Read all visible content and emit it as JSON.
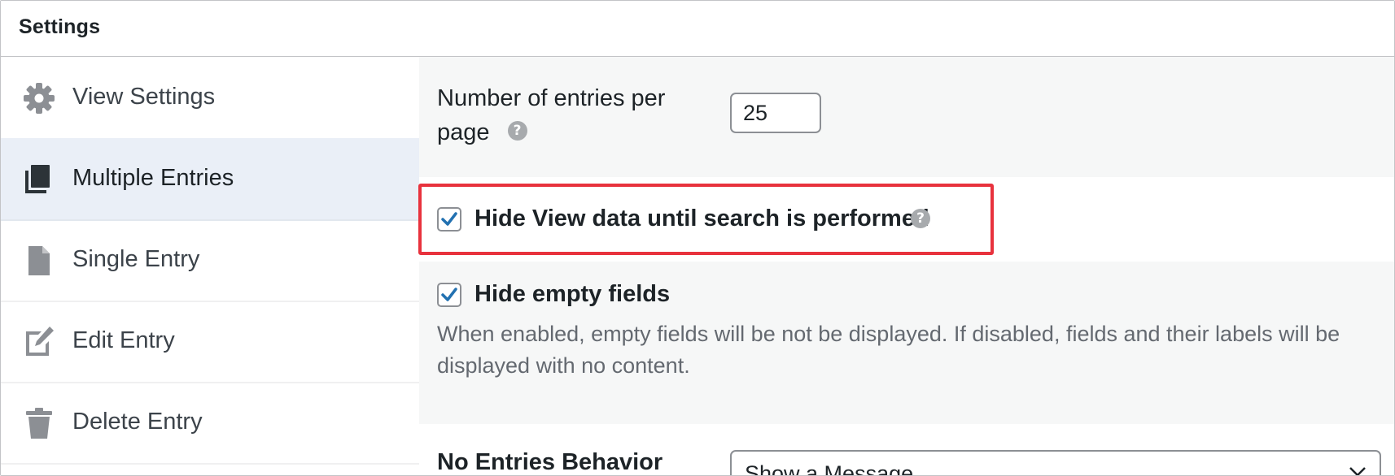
{
  "panel": {
    "title": "Settings"
  },
  "sidebar": {
    "items": [
      {
        "label": "View Settings",
        "icon": "gear-icon",
        "active": false
      },
      {
        "label": "Multiple Entries",
        "icon": "copy-icon",
        "active": true
      },
      {
        "label": "Single Entry",
        "icon": "document-icon",
        "active": false
      },
      {
        "label": "Edit Entry",
        "icon": "edit-icon",
        "active": false
      },
      {
        "label": "Delete Entry",
        "icon": "trash-icon",
        "active": false
      }
    ]
  },
  "main": {
    "entries_per_page": {
      "label_line1": "Number of entries per",
      "label_line2": "page",
      "help": "?",
      "value": "25"
    },
    "hide_view_data": {
      "label": "Hide View data until search is performed",
      "checked": true,
      "help": "?"
    },
    "hide_empty_fields": {
      "label": "Hide empty fields",
      "checked": true,
      "description": "When enabled, empty fields will be not be displayed. If disabled, fields and their labels will be displayed with no content."
    },
    "no_entries_behavior": {
      "label": "No Entries Behavior",
      "selected": "Show a Message"
    }
  },
  "colors": {
    "highlight": "#e8323d",
    "check": "#2271b1",
    "active_tab_bg": "#eaeff7"
  }
}
